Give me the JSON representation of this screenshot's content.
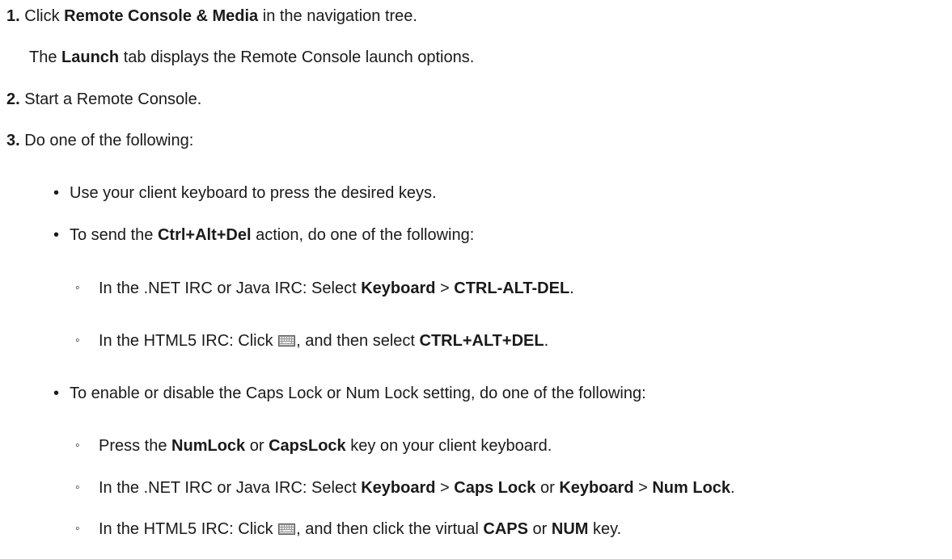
{
  "steps": [
    {
      "number": "1.",
      "text": {
        "a": "Click ",
        "b1": "Remote Console & Media",
        "c": " in the navigation tree."
      },
      "result": {
        "a": "The ",
        "b1": "Launch",
        "c": " tab displays the Remote Console launch options."
      }
    },
    {
      "number": "2.",
      "text": "Start a Remote Console."
    },
    {
      "number": "3.",
      "text": "Do one of the following:",
      "bullet_char": "•",
      "sub_bullet_char": "◦",
      "options": [
        {
          "text": "Use your client keyboard to press the desired keys."
        },
        {
          "a": "To send the ",
          "b1": "Ctrl+Alt+Del",
          "c": " action, do one of the following:",
          "sub": [
            {
              "a": "In the .NET IRC or Java IRC: Select ",
              "b1": "Keyboard",
              "c": " > ",
              "b2": "CTRL-ALT-DEL",
              "d": "."
            },
            {
              "a": "In the HTML5 IRC: Click ",
              "icon": "keyboard-icon",
              "c": ", and then select ",
              "b1": "CTRL+ALT+DEL",
              "d": "."
            }
          ]
        },
        {
          "text": "To enable or disable the Caps Lock or Num Lock setting, do one of the following:",
          "sub": [
            {
              "a": "Press the ",
              "b1": "NumLock",
              "c": " or ",
              "b2": "CapsLock",
              "d": " key on your client keyboard."
            },
            {
              "a": "In the .NET IRC or Java IRC: Select ",
              "b1": "Keyboard",
              "c": " > ",
              "b2": "Caps Lock",
              "d": " or ",
              "b3": "Keyboard",
              "e": " > ",
              "b4": "Num Lock",
              "f": "."
            },
            {
              "a": "In the HTML5 IRC: Click ",
              "icon": "keyboard-icon",
              "c": ", and then click the virtual ",
              "b1": "CAPS",
              "d": " or ",
              "b2": "NUM",
              "e": " key."
            }
          ]
        }
      ]
    }
  ]
}
